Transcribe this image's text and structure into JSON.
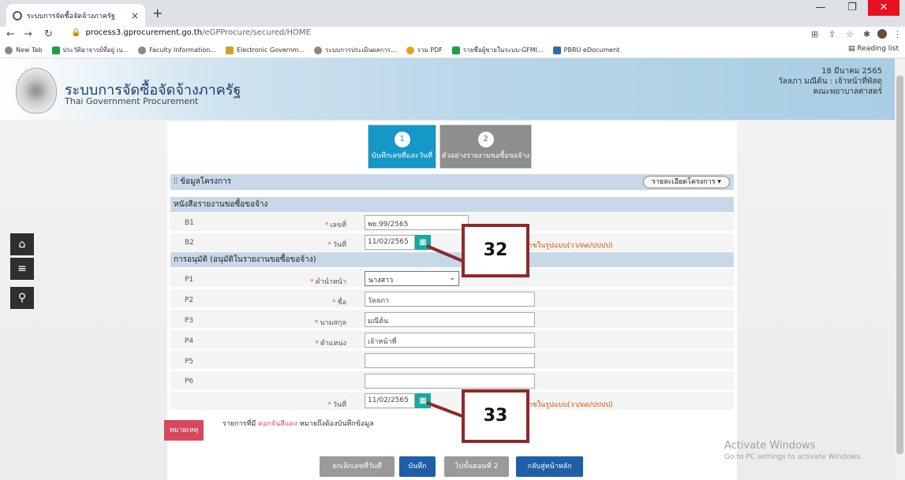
{
  "browser": {
    "tab_title": "ระบบการจัดซื้อจัดจ้างภาครัฐ",
    "tab_close": "×",
    "new_tab": "+",
    "url_domain": "process3.gprocurement.go.th",
    "url_path": "/eGPProcure/secured/HOME",
    "bookmarks": [
      "New Tab",
      "ประวัติอาจารย์ที่อยู่ เบ...",
      "Faculty Information...",
      "Electronic Governm...",
      "ระบบการประเมินผลการ...",
      "รวม PDF",
      "รายชื่อผู้ขายในระบบ-GFMI...",
      "PBRU eDocument"
    ],
    "reading_list": "Reading list"
  },
  "site": {
    "title": "ระบบการจัดซื้อจัดจ้างภาครัฐ",
    "subtitle": "Thai Government Procurement",
    "date": "18 มีนาคม 2565",
    "user": "วัลลภา มณีต้น : เจ้าหน้าที่พัสดุ",
    "org": "คณะพยาบาลศาสตร์"
  },
  "steps": [
    {
      "num": "1",
      "label": "บันทึกเลขที่และวันที่"
    },
    {
      "num": "2",
      "label": "ตัวอย่างรายงานขอซื้อขอจ้าง"
    }
  ],
  "project_section": {
    "title": "ข้อมูลโครงการ",
    "details_button": "รายละเอียดโครงการ"
  },
  "report_section": {
    "title": "หนังสือรายงานขอซื้อขอจ้าง",
    "rows": [
      {
        "key": "B1",
        "label": "เลขที่",
        "value": "พย.99/2565"
      },
      {
        "key": "B2",
        "label": "วันที่",
        "value": "11/02/2565",
        "hint": "ระบุปีพุทธศักราชในรูปแบบ(วว/ดด/ปปปป)"
      }
    ]
  },
  "approval_section": {
    "title": "การอนุมัติ (อนุมัติในรายงานขอซื้อขอจ้าง)",
    "rows": [
      {
        "key": "P1",
        "label": "คำนำหน้า",
        "value": "นางสาว"
      },
      {
        "key": "P2",
        "label": "ชื่อ",
        "value": "วัลลภา"
      },
      {
        "key": "P3",
        "label": "นามสกุล",
        "value": "มณีต้น"
      },
      {
        "key": "P4",
        "label": "ตำแหน่ง",
        "value": "เจ้าหน้าที่"
      },
      {
        "key": "P5",
        "label": "",
        "value": ""
      },
      {
        "key": "P6",
        "label": "",
        "value": ""
      },
      {
        "key": "",
        "label": "วันที่",
        "value": "11/02/2565",
        "hint": "ระบุปีพุทธศักราชในรูปแบบ(วว/ดด/ปปปป)"
      }
    ]
  },
  "note": {
    "button": "หมายเหตุ",
    "text_prefix": "รายการที่มี",
    "text_red": "ดอกจันสีแดง",
    "text_suffix": "หมายถึงต้องบันทึกข้อมูล"
  },
  "buttons": {
    "cancel": "ยกเลิกเลขที่วันที่",
    "save": "บันทึก",
    "next": "ไปขั้นตอนที่ 2",
    "home": "กลับสู่หน้าหลัก"
  },
  "callouts": [
    "32",
    "33"
  ],
  "watermark": {
    "line1": "Activate Windows",
    "line2": "Go to PC settings to activate Windows."
  },
  "colors": {
    "accent": "#1597c7",
    "calendar": "#1aa8a0",
    "note_red": "#d9475d",
    "callout_border": "#8e2a2a"
  }
}
